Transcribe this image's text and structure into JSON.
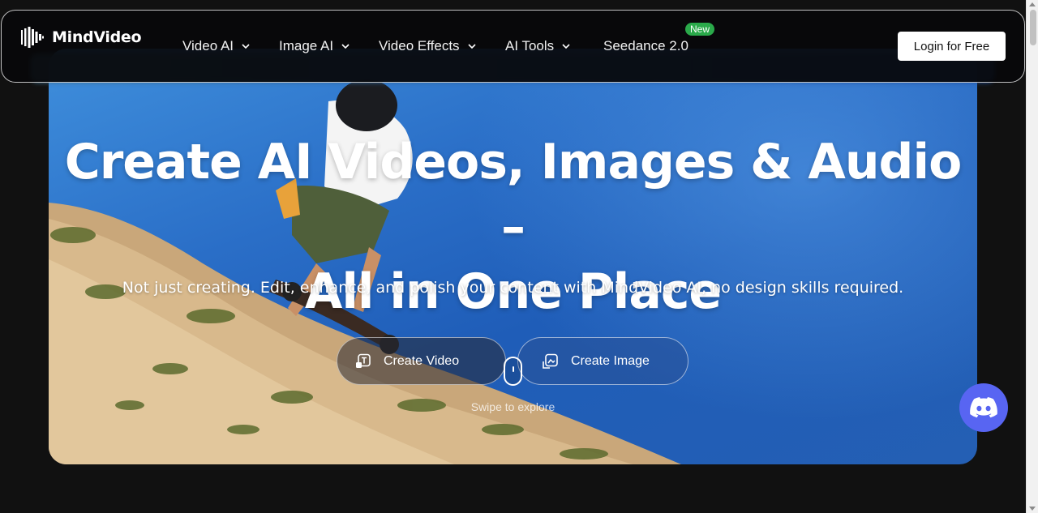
{
  "brand": {
    "name": "MindVideo"
  },
  "nav": {
    "items": [
      {
        "label": "Video AI",
        "has_dropdown": true
      },
      {
        "label": "Image AI",
        "has_dropdown": true
      },
      {
        "label": "Video Effects",
        "has_dropdown": true
      },
      {
        "label": "AI Tools",
        "has_dropdown": true
      },
      {
        "label": "Seedance 2.0",
        "has_dropdown": false,
        "badge": "New"
      }
    ],
    "login_label": "Login for Free"
  },
  "hero": {
    "title_line1": "Create AI Videos, Images & Audio –",
    "title_line2": "All in One Place",
    "subtitle": "Not just creating. Edit, enhance, and polish your content with MindVideo AI, no design skills required.",
    "cta_video": "Create Video",
    "cta_image": "Create Image",
    "swipe_hint": "Swipe to explore"
  },
  "colors": {
    "accent_new_badge": "#2aa94a",
    "discord": "#5865f2",
    "page_bg": "#111111"
  },
  "icons": [
    "logo-mark-icon",
    "chevron-down-icon",
    "create-video-icon",
    "create-image-icon",
    "scroll-mouse-icon",
    "discord-icon"
  ]
}
